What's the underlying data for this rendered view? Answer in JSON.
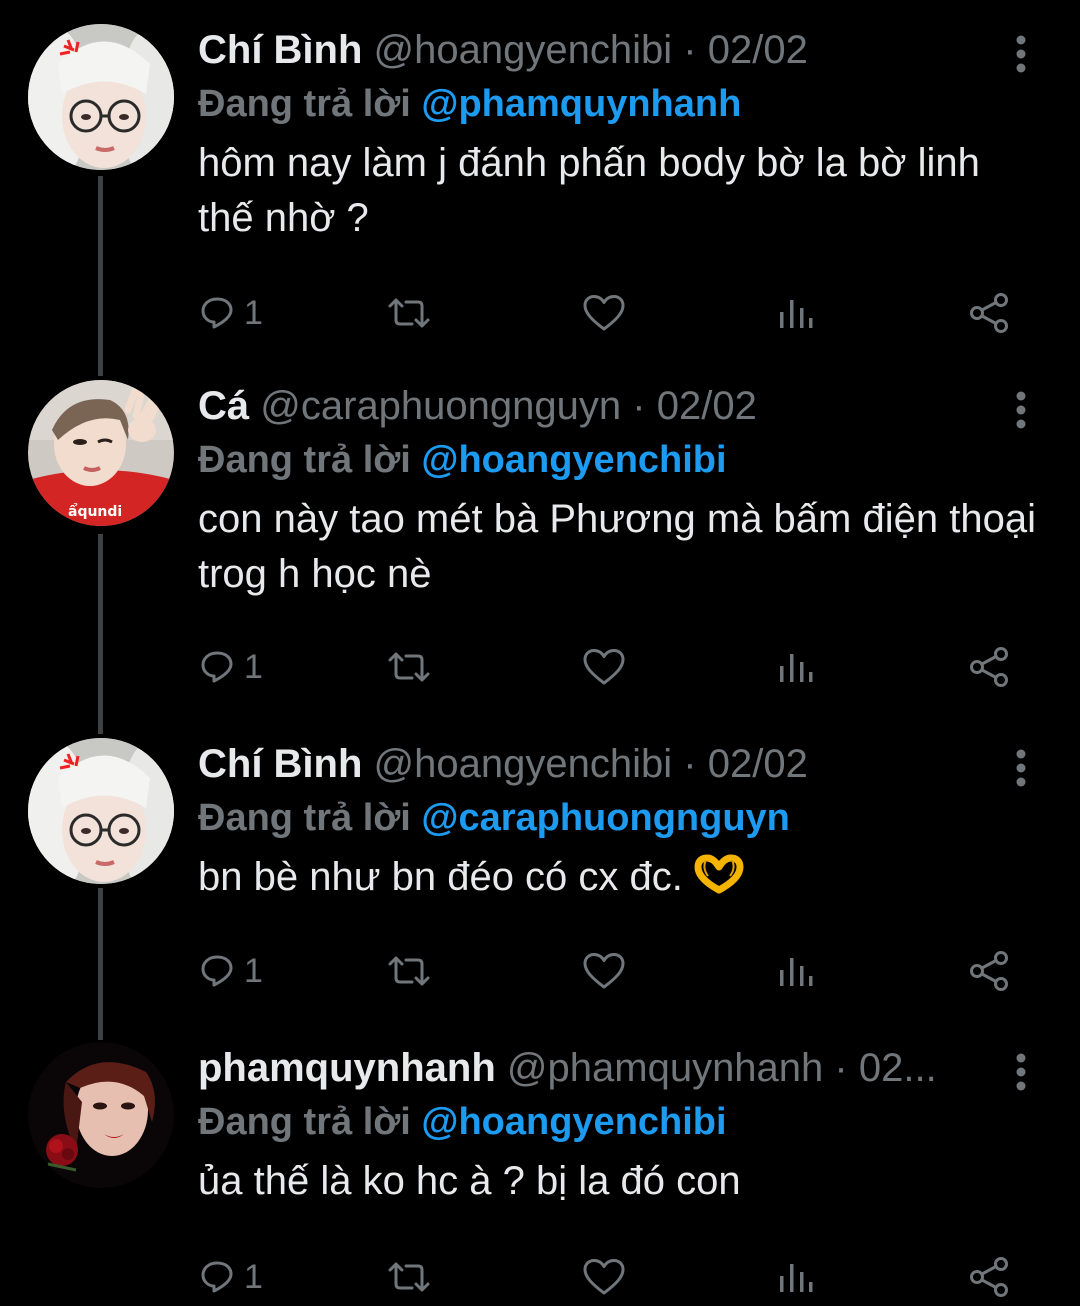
{
  "tweets": [
    {
      "name": "Chí Bình",
      "handle": "@hoangyenchibi",
      "separator": "·",
      "date": "02/02",
      "replying_prefix": "Đang trả lời ",
      "replying_to": "@phamquynhanh",
      "text": "hôm nay làm j đánh phấn body bờ la bờ linh thế nhờ ?",
      "reply_count": "1",
      "avatar": "woman-glasses-gray-hair"
    },
    {
      "name": "Cá",
      "handle": "@caraphuongnguyn",
      "separator": "·",
      "date": "02/02",
      "replying_prefix": "Đang trả lời ",
      "replying_to": "@hoangyenchibi",
      "text": "con này tao mét bà Phương mà bấm điện thoại trog h học nè",
      "reply_count": "1",
      "avatar": "woman-red-shirt-peace-sign"
    },
    {
      "name": "Chí Bình",
      "handle": "@hoangyenchibi",
      "separator": "·",
      "date": "02/02",
      "replying_prefix": "Đang trả lời ",
      "replying_to": "@caraphuongnguyn",
      "text": "bn bè như bn đéo có cx đc.",
      "emoji": "heart-hands-emoji",
      "reply_count": "1",
      "avatar": "woman-glasses-gray-hair"
    },
    {
      "name": "phamquynhanh",
      "handle": "@phamquynhanh",
      "separator": "·",
      "date": "02...",
      "replying_prefix": "Đang trả lời ",
      "replying_to": "@hoangyenchibi",
      "text": "ủa thế là ko hc à ? bị la đó con",
      "reply_count": "1",
      "avatar": "woman-red-lips-rose"
    }
  ],
  "icons": {
    "reply": "reply-icon",
    "retweet": "retweet-icon",
    "like": "heart-icon",
    "views": "analytics-icon",
    "share": "share-icon",
    "more": "more-vertical-icon"
  },
  "colors": {
    "background": "#000000",
    "text": "#e7e9ea",
    "secondary": "#71767b",
    "accent": "#1d9bf0",
    "thread_line": "#3e4144"
  }
}
